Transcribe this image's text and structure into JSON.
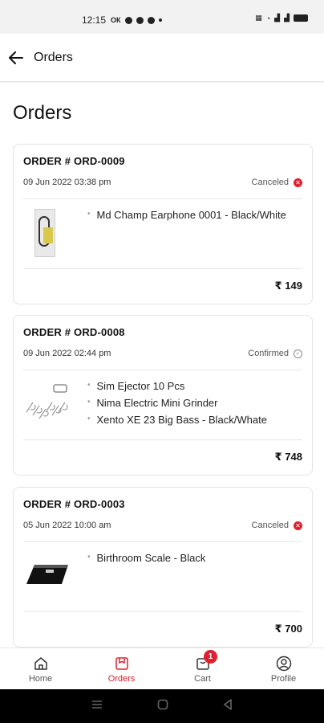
{
  "status_bar": {
    "time": "12:15",
    "left_icons_text": "ОК"
  },
  "app_bar": {
    "title": "Orders"
  },
  "page": {
    "title": "Orders"
  },
  "orders": [
    {
      "number": "ORDER # ORD-0009",
      "date": "09 Jun 2022 03:38 pm",
      "status": "Canceled",
      "items": [
        "Md Champ Earphone 0001 - Black/White"
      ],
      "total": "₹ 149"
    },
    {
      "number": "ORDER # ORD-0008",
      "date": "09 Jun 2022 02:44 pm",
      "status": "Confirmed",
      "items": [
        "Sim Ejector 10 Pcs",
        "Nima Electric Mini Grinder",
        "Xento XE 23 Big Bass - Black/Whate"
      ],
      "total": "₹ 748"
    },
    {
      "number": "ORDER # ORD-0003",
      "date": "05 Jun 2022 10:00 am",
      "status": "Canceled",
      "items": [
        "Birthroom Scale - Black"
      ],
      "total": "₹ 700"
    }
  ],
  "bottom_nav": {
    "items": [
      {
        "label": "Home",
        "icon": "home-icon"
      },
      {
        "label": "Orders",
        "icon": "orders-icon"
      },
      {
        "label": "Cart",
        "icon": "cart-icon",
        "badge": "1"
      },
      {
        "label": "Profile",
        "icon": "profile-icon"
      }
    ],
    "active": "Orders"
  },
  "colors": {
    "accent": "#e0202e",
    "canceled": "#e0202e",
    "confirmed": "#8a8a8a"
  }
}
